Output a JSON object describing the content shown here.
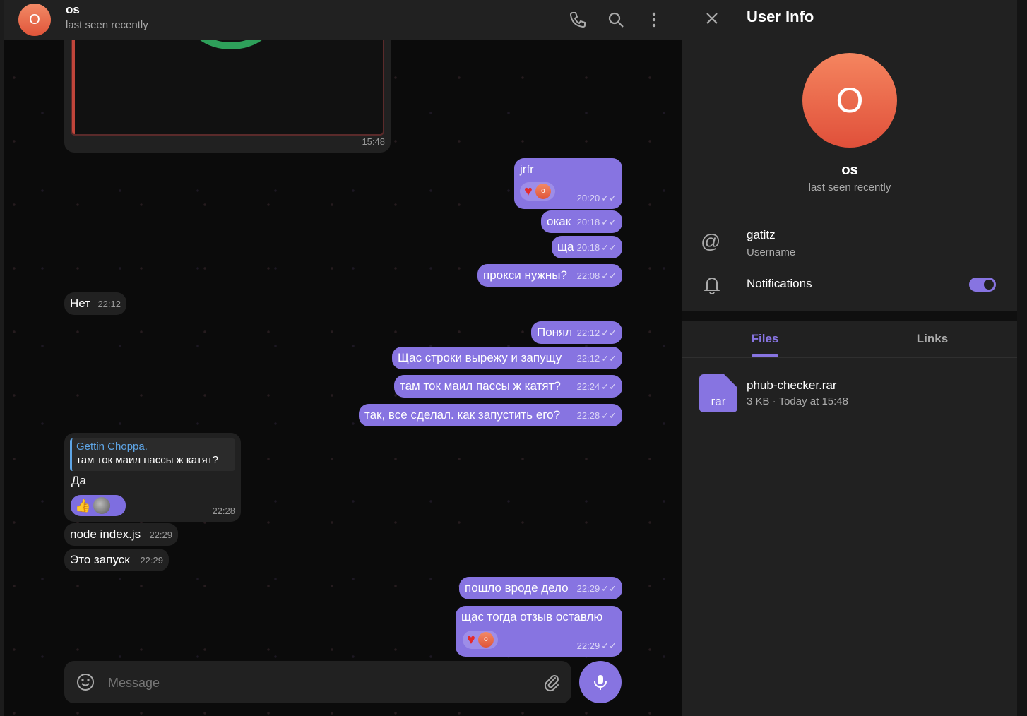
{
  "header": {
    "avatar_letter": "O",
    "name": "os",
    "status": "last seen recently"
  },
  "messages": {
    "m1_time": "15:48",
    "m2_text": "jrfr",
    "m2_time": "20:20",
    "m3_text": "окак",
    "m3_time": "20:18",
    "m4_text": "ща",
    "m4_time": "20:18",
    "m5_text": "прокси нужны?",
    "m5_time": "22:08",
    "m6_text": "Нет",
    "m6_time": "22:12",
    "m7_text": "Понял",
    "m7_time": "22:12",
    "m8_text": "Щас строки вырежу и запущу",
    "m8_time": "22:12",
    "m9_text": "там ток маил пассы ж катят?",
    "m9_time": "22:24",
    "m10_text": "так, все сделал. как запустить его?",
    "m10_time": "22:28",
    "m11_reply_name": "Gettin Choppa.",
    "m11_reply_text": "там ток маил пассы ж катят?",
    "m11_text": "Да",
    "m11_time": "22:28",
    "m12_text": "node index.js",
    "m12_time": "22:29",
    "m13_text": "Это запуск",
    "m13_time": "22:29",
    "m14_text": "пошло вроде дело",
    "m14_time": "22:29",
    "m15_text": "щас тогда отзыв оставлю",
    "m15_time": "22:29",
    "reaction_avatar_letter": "o"
  },
  "composer": {
    "placeholder": "Message"
  },
  "side": {
    "title": "User Info",
    "avatar_letter": "O",
    "name": "os",
    "status": "last seen recently",
    "username": "gatitz",
    "username_label": "Username",
    "notifications_label": "Notifications",
    "notifications_on": true,
    "tabs": [
      {
        "label": "Files",
        "active": true
      },
      {
        "label": "Links",
        "active": false
      }
    ],
    "file": {
      "ext": "rar",
      "name": "phub-checker.rar",
      "meta": "3 KB · Today at 15:48"
    }
  },
  "colors": {
    "accent": "#8774e1",
    "panel": "#212121",
    "avatar": "#e0553a"
  }
}
